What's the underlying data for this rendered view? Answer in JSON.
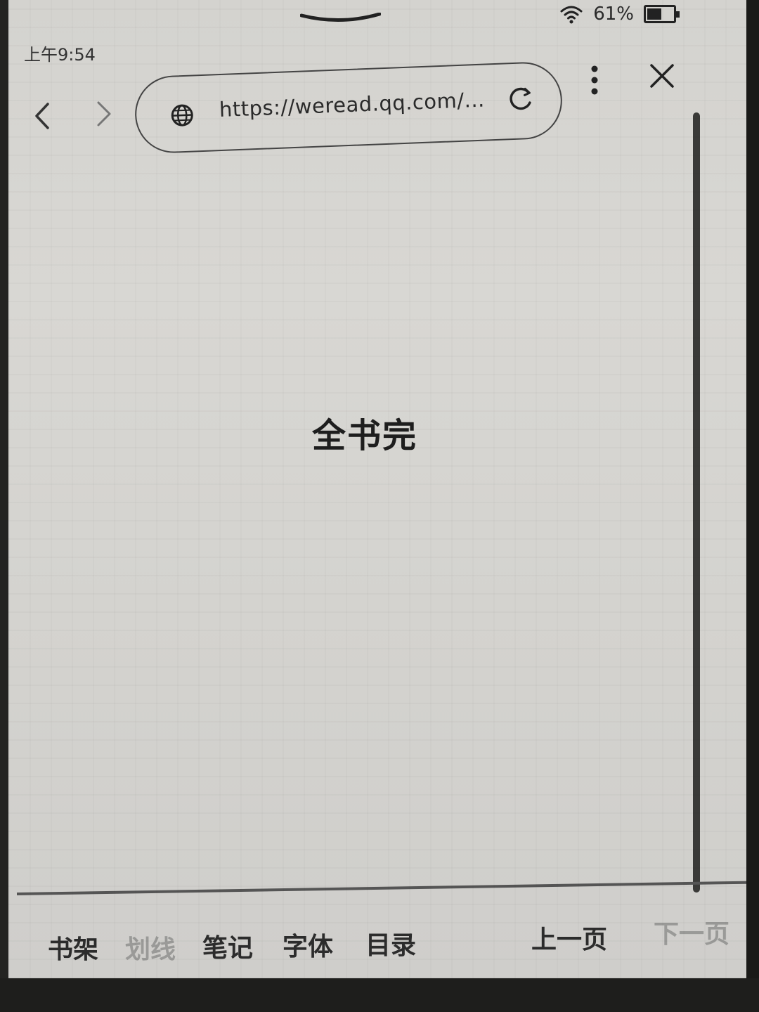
{
  "status": {
    "time": "上午9:54",
    "battery_percent": "61%",
    "battery_level": 0.61
  },
  "browser": {
    "url": "https://weread.qq.com/...",
    "icons": {
      "back": "chevron-left-icon",
      "forward": "chevron-right-icon",
      "globe": "globe-icon",
      "reload": "reload-icon",
      "menu": "more-vertical-icon",
      "close": "close-icon"
    }
  },
  "content": {
    "end_text": "全书完"
  },
  "toolbar": {
    "bookshelf": "书架",
    "underline": "划线",
    "notes": "笔记",
    "font": "字体",
    "toc": "目录",
    "prev_page": "上一页",
    "next_page": "下一页"
  },
  "colors": {
    "screen": "#d6d5d1",
    "ink": "#1e1e1e",
    "dimmed": "#9a9a98"
  }
}
